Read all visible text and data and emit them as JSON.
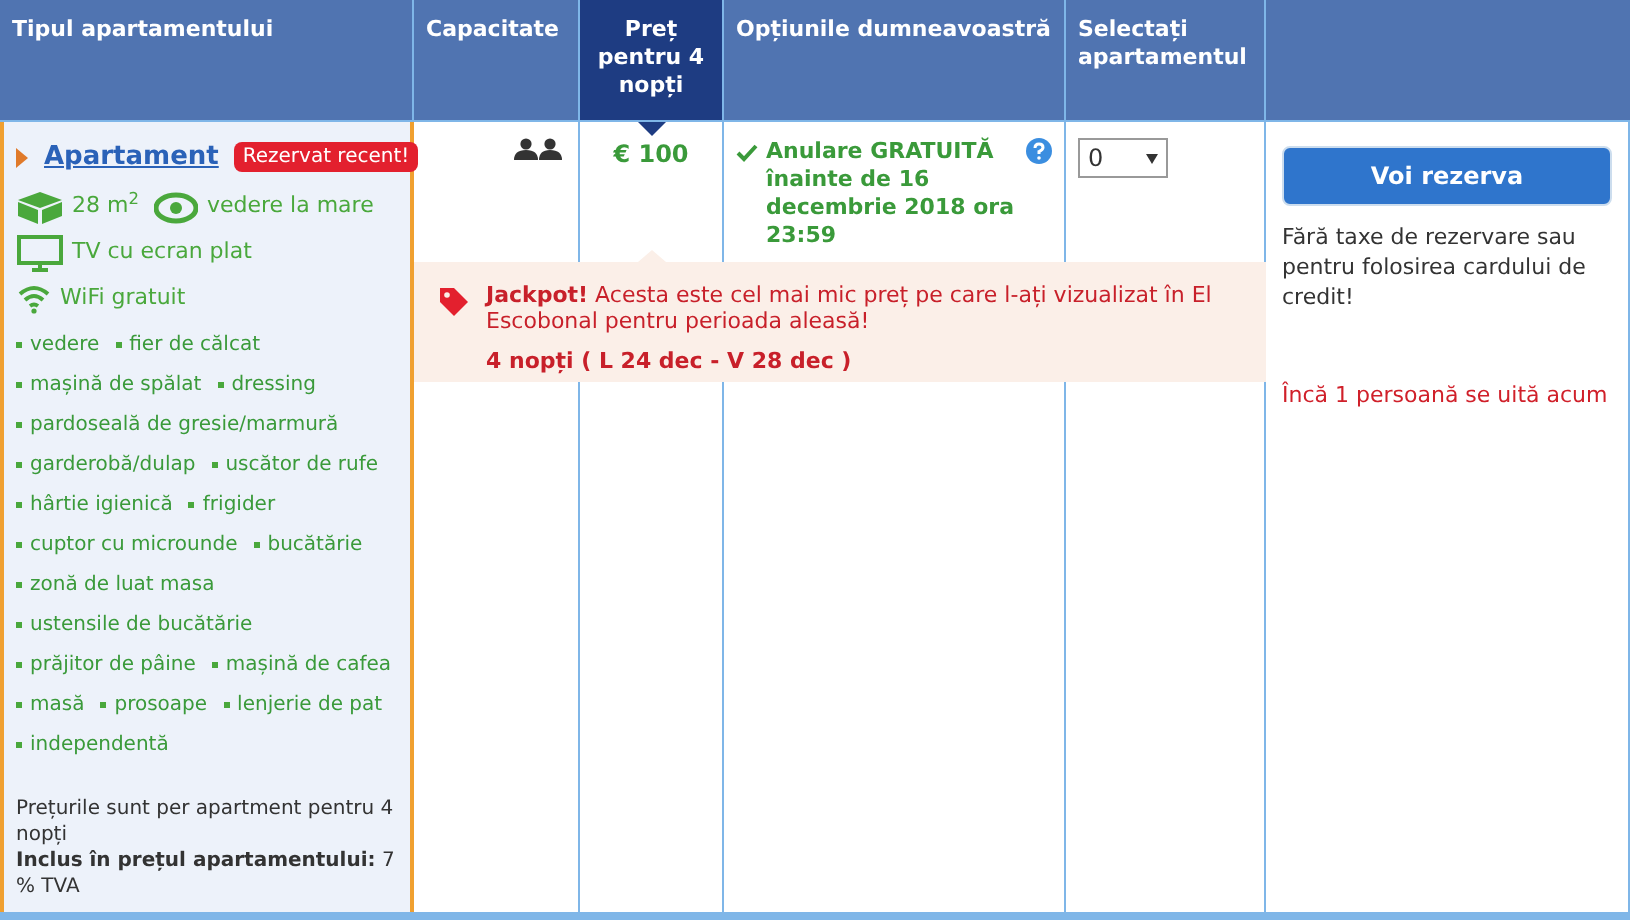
{
  "columns": [
    {
      "label": "Tipul apartamentului",
      "selected": false
    },
    {
      "label": "Capacitate",
      "selected": false
    },
    {
      "label": "Preț pentru 4 nopți",
      "selected": true
    },
    {
      "label": "Opțiunile dumneavoastră",
      "selected": false
    },
    {
      "label": "Selectați apartamentul",
      "selected": false
    }
  ],
  "room": {
    "name": "Apartament",
    "badge": "Rezervat recent!",
    "features": [
      {
        "kind": "size",
        "label": "28 m$^{2}$"
      },
      {
        "kind": "view",
        "label": "vedere la mare"
      },
      {
        "kind": "tv",
        "label": "TV cu ecran plat"
      },
      {
        "kind": "wifi",
        "label": "WiFi gratuit"
      }
    ],
    "amenity_rows": [
      [
        "vedere",
        "fier de călcat"
      ],
      [
        "mașină de spălat",
        "dressing"
      ],
      [
        "pardoseală de gresie/marmură"
      ],
      [
        "garderobă/dulap",
        "uscător de rufe"
      ],
      [
        "hârtie igienică",
        "frigider"
      ],
      [
        "cuptor cu microunde",
        "bucătărie"
      ],
      [
        "zonă de luat masa"
      ],
      [
        "ustensile de bucătărie"
      ],
      [
        "prăjitor de pâine",
        "mașină de cafea"
      ],
      [
        "masă",
        "prosoape",
        "lenjerie de pat"
      ],
      [
        "independentă"
      ]
    ],
    "price_note": "Prețurile sunt per apartment pentru 4 nopți",
    "included": "**Inclus în prețul apartamentului:** 7 % TVA"
  },
  "price": "€ 100",
  "cancellation": "Anulare GRATUITĂ înainte de 16 decembrie 2018 ora 23:59",
  "quantity": "0",
  "jackpot": {
    "text": "**Jackpot!** Acesta este cel mai mic preț pe care l-ați vizualizat în El Escobonal pentru perioada aleasă!",
    "dates": "4 nopți ( L 24 dec - V 28 dec )"
  },
  "reserve_button": "Voi rezerva",
  "no_fees": "Fără taxe de rezervare sau pentru folosirea cardului de credit!",
  "watching": "Încă 1 persoană se uită acum"
}
